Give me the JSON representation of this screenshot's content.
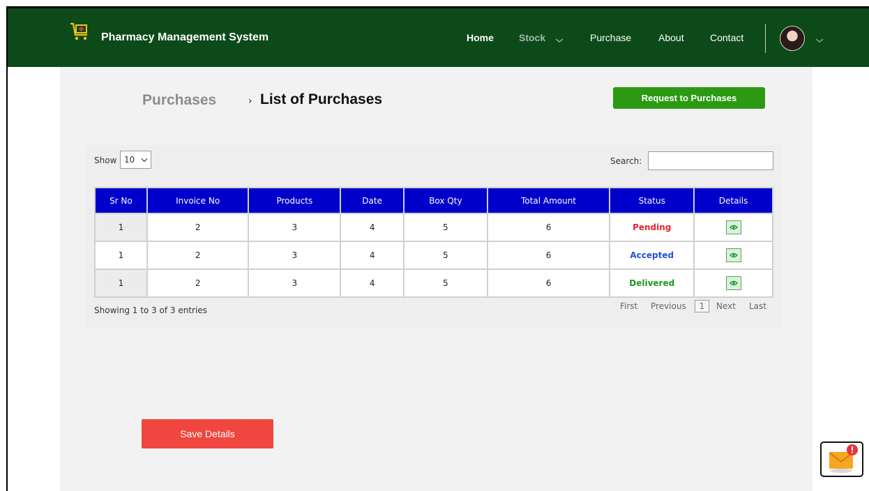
{
  "navbar": {
    "brand": "Pharmacy Management System",
    "brand_icon": "pharmacy-cart-icon",
    "links": {
      "home": "Home",
      "stock": "Stock",
      "purchase": "Purchase",
      "about": "About",
      "contact": "Contact"
    },
    "active_link": "Stock"
  },
  "breadcrumb": {
    "parent": "Purchases",
    "separator": "›",
    "current": "List of Purchases"
  },
  "actions": {
    "request_label": "Request to Purchases",
    "save_label": "Save Details"
  },
  "table_controls": {
    "show_label": "Show",
    "page_size": "10",
    "search_label": "Search:",
    "search_value": ""
  },
  "table": {
    "columns": [
      "Sr No",
      "Invoice No",
      "Products",
      "Date",
      "Box Qty",
      "Total Amount",
      "Status",
      "Details"
    ],
    "rows": [
      {
        "sr": "1",
        "invoice": "2",
        "products": "3",
        "date": "4",
        "box_qty": "5",
        "total": "6",
        "status": "Pending"
      },
      {
        "sr": "1",
        "invoice": "2",
        "products": "3",
        "date": "4",
        "box_qty": "5",
        "total": "6",
        "status": "Accepted"
      },
      {
        "sr": "1",
        "invoice": "2",
        "products": "3",
        "date": "4",
        "box_qty": "5",
        "total": "6",
        "status": "Delivered"
      }
    ],
    "details_icon": "eye-icon"
  },
  "pagination": {
    "summary": "Showing 1 to 3 of 3 entries",
    "first": "First",
    "previous": "Previous",
    "current_page": "1",
    "next": "Next",
    "last": "Last"
  },
  "colors": {
    "navbar": "#0c4a1a",
    "table_header": "#0000cd",
    "request_button": "#2b9a12",
    "save_button": "#f0463f",
    "pending": "#e3262f",
    "accepted": "#2450d8",
    "delivered": "#1c9a1c"
  }
}
